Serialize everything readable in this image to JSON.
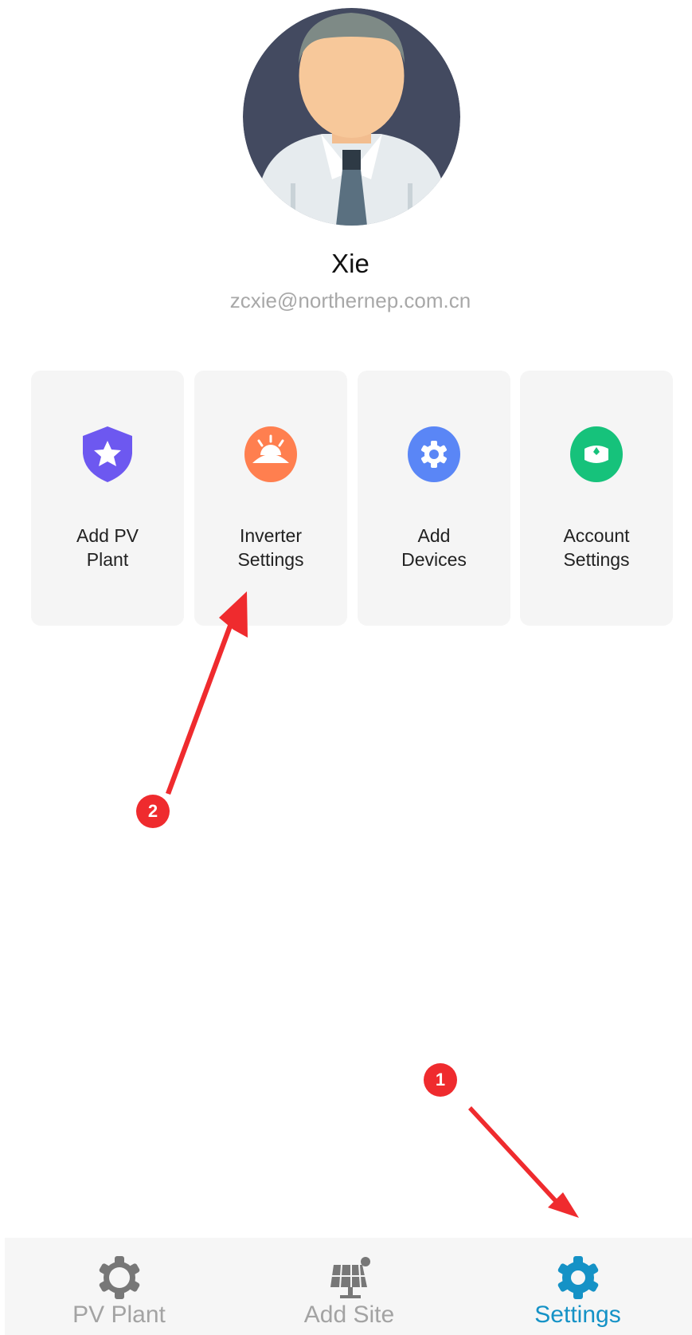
{
  "profile": {
    "name": "Xie",
    "email": "zcxie@northernep.com.cn"
  },
  "menu": {
    "items": [
      {
        "label_line1": "Add PV",
        "label_line2": "Plant",
        "icon": "shield-star-icon",
        "color": "#6d58f0"
      },
      {
        "label_line1": "Inverter",
        "label_line2": "Settings",
        "icon": "sunrise-icon",
        "color": "#ff7f4f"
      },
      {
        "label_line1": "Add",
        "label_line2": "Devices",
        "icon": "gear-icon",
        "color": "#5a86f6"
      },
      {
        "label_line1": "Account",
        "label_line2": "Settings",
        "icon": "account-icon",
        "color": "#16c27b"
      }
    ]
  },
  "annotations": {
    "badge1": "1",
    "badge2": "2",
    "color": "#ef2b2e"
  },
  "bottom_nav": {
    "items": [
      {
        "label": "PV Plant",
        "icon": "gear-outline-icon",
        "active": false
      },
      {
        "label": "Add Site",
        "icon": "solar-panel-icon",
        "active": false
      },
      {
        "label": "Settings",
        "icon": "gear-icon",
        "active": true
      }
    ],
    "active_color": "#1592c6",
    "inactive_color": "#a3a3a3"
  }
}
